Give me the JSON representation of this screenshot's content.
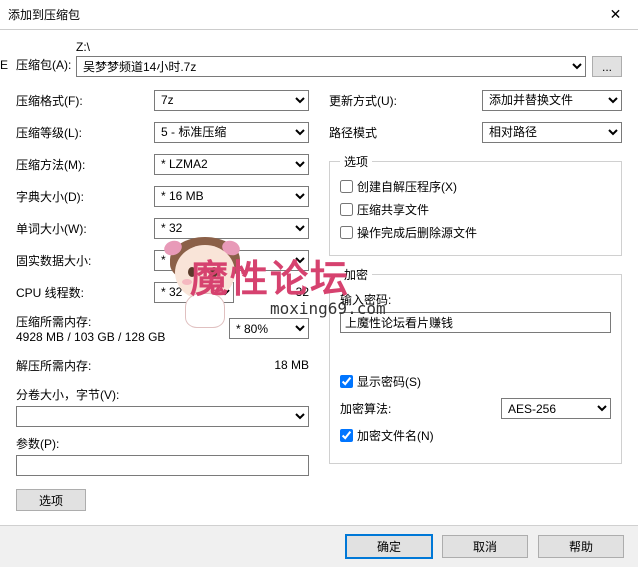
{
  "title": "添加到压缩包",
  "archive": {
    "label": "压缩包(A):",
    "path": "Z:\\",
    "filename": "吴梦梦频道14小时.7z",
    "browse": "..."
  },
  "left": {
    "format_label": "压缩格式(F):",
    "format_value": "7z",
    "level_label": "压缩等级(L):",
    "level_value": "5 - 标准压缩",
    "method_label": "压缩方法(M):",
    "method_value": "* LZMA2",
    "dict_label": "字典大小(D):",
    "dict_value": "* 16 MB",
    "word_label": "单词大小(W):",
    "word_value": "* 32",
    "solid_label": "固实数据大小:",
    "solid_value": "*",
    "cpu_label": "CPU 线程数:",
    "cpu_value": "* 32",
    "cpu_max": "32",
    "mem_compress_label": "压缩所需内存:",
    "mem_compress_value": "4928 MB / 103 GB / 128 GB",
    "mem_compress_pct": "* 80%",
    "mem_decompress_label": "解压所需内存:",
    "mem_decompress_value": "18 MB",
    "split_label": "分卷大小，字节(V):",
    "params_label": "参数(P):",
    "options_btn": "选项"
  },
  "right": {
    "update_label": "更新方式(U):",
    "update_value": "添加并替换文件",
    "path_label": "路径模式",
    "path_value": "相对路径",
    "options_legend": "选项",
    "opt_sfx": "创建自解压程序(X)",
    "opt_shared": "压缩共享文件",
    "opt_delete": "操作完成后删除源文件",
    "encrypt_legend": "加密",
    "pwd_label": "输入密码:",
    "pwd_value": "上魔性论坛看片赚钱",
    "show_pwd": "显示密码(S)",
    "enc_method_label": "加密算法:",
    "enc_method_value": "AES-256",
    "enc_names": "加密文件名(N)"
  },
  "buttons": {
    "ok": "确定",
    "cancel": "取消",
    "help": "帮助"
  },
  "watermark": {
    "main": "魔性论坛",
    "sub": "moxing69.com"
  },
  "edge": "E"
}
